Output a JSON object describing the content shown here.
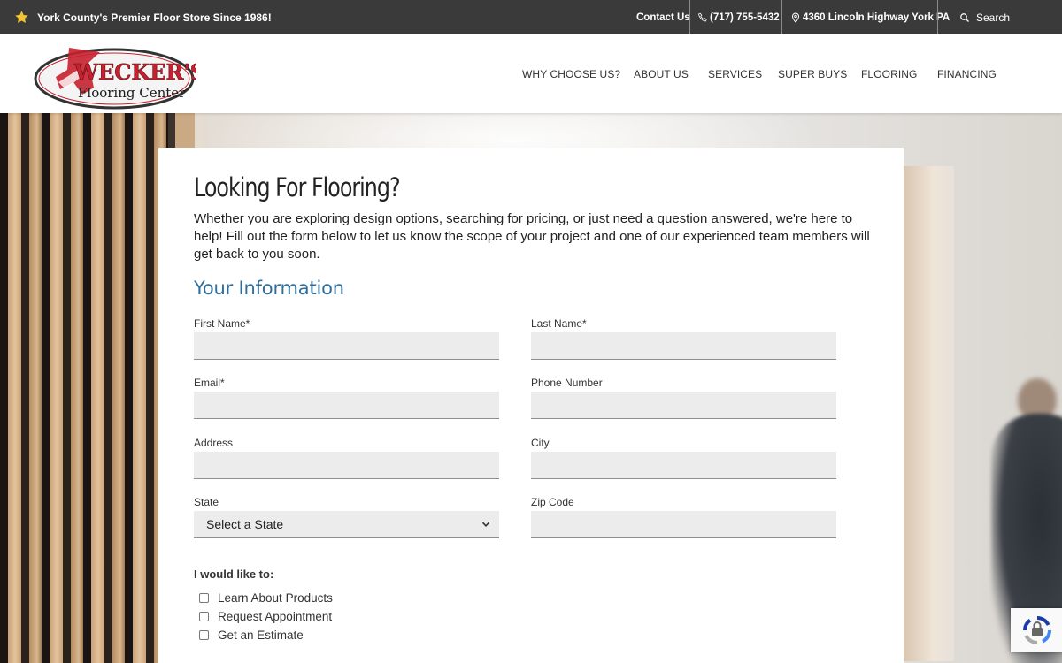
{
  "topbar": {
    "tagline": "York County's Premier Floor Store Since 1986!",
    "star_icon": "star-icon",
    "contact": "Contact Us",
    "phone": "(717) 755-5432",
    "address": "4360 Lincoln Highway York PA",
    "search": "Search"
  },
  "logo": {
    "line1": "WECKER'S",
    "line2": "Flooring Center"
  },
  "nav": [
    "WHY CHOOSE US?",
    "ABOUT US",
    "SERVICES",
    "SUPER BUYS",
    "FLOORING",
    "FINANCING"
  ],
  "form": {
    "title": "Looking For Flooring?",
    "intro": "Whether you are exploring design options, searching for pricing, or just need a question answered, we're here to help! Fill out the form below to let us know the scope of your project and one of our experienced team members will get back to you soon.",
    "section": "Your Information",
    "fields": {
      "first_name": "First Name*",
      "last_name": "Last Name*",
      "email": "Email*",
      "phone": "Phone Number",
      "address": "Address",
      "city": "City",
      "state": "State",
      "zip": "Zip Code"
    },
    "state_selected": "Select a State",
    "like_label": "I would like to:",
    "options": [
      "Learn About Products",
      "Request Appointment",
      "Get an Estimate"
    ]
  },
  "colors": {
    "topbar_bg": "#3a3a3a",
    "section_heading": "#2f6e9c",
    "logo_red": "#c8202f"
  }
}
